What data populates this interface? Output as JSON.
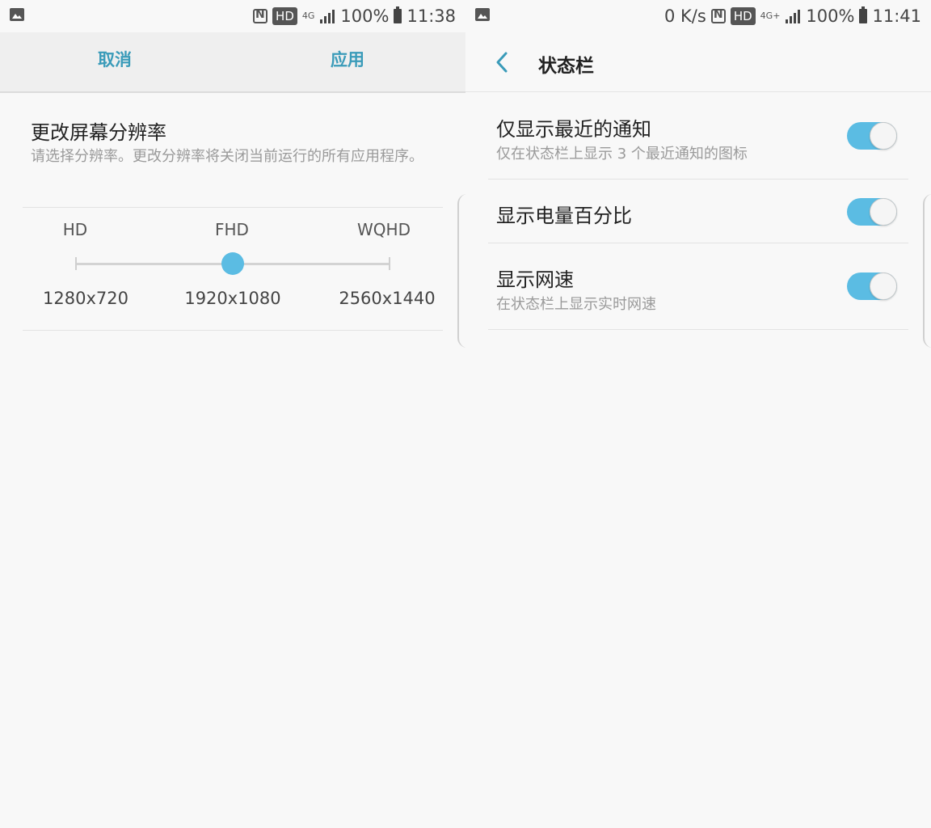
{
  "left": {
    "status": {
      "signal_label": "4G",
      "battery": "100%",
      "time": "11:38",
      "hd_badge": "HD"
    },
    "header": {
      "cancel": "取消",
      "apply": "应用"
    },
    "resolution": {
      "title": "更改屏幕分辨率",
      "description": "请选择分辨率。更改分辨率将关闭当前运行的所有应用程序。",
      "options": [
        {
          "name": "HD",
          "value": "1280x720"
        },
        {
          "name": "FHD",
          "value": "1920x1080"
        },
        {
          "name": "WQHD",
          "value": "2560x1440"
        }
      ],
      "selected_index": 1
    }
  },
  "right": {
    "status": {
      "net_speed": "0 K/s",
      "signal_label": "4G+",
      "battery": "100%",
      "time": "11:41",
      "hd_badge": "HD"
    },
    "header": {
      "title": "状态栏"
    },
    "settings": [
      {
        "title": "仅显示最近的通知",
        "subtitle": "仅在状态栏上显示 3 个最近通知的图标",
        "enabled": true
      },
      {
        "title": "显示电量百分比",
        "subtitle": "",
        "enabled": true
      },
      {
        "title": "显示网速",
        "subtitle": "在状态栏上显示实时网速",
        "enabled": true
      }
    ]
  },
  "colors": {
    "accent": "#5bbce3",
    "header_link": "#3a9bb9"
  }
}
